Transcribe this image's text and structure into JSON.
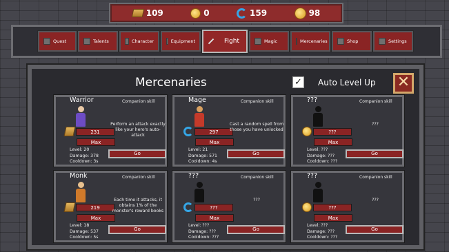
{
  "resources": [
    {
      "icon": "book-icon",
      "value": "109"
    },
    {
      "icon": "coin-icon",
      "value": "0"
    },
    {
      "icon": "mana-swirl-icon",
      "value": "159"
    },
    {
      "icon": "gold-coin-icon",
      "value": "98"
    }
  ],
  "tabs": [
    {
      "label": "Quest",
      "icon": "quest-icon"
    },
    {
      "label": "Talents",
      "icon": "talents-icon"
    },
    {
      "label": "Character",
      "icon": "character-icon"
    },
    {
      "label": "Equipment",
      "icon": "helmet-icon"
    },
    {
      "label": "Fight",
      "icon": "sword-icon",
      "active": true
    },
    {
      "label": "Magic",
      "icon": "wand-icon"
    },
    {
      "label": "Mercenaries",
      "icon": "mercenary-icon"
    },
    {
      "label": "Shop",
      "icon": "coin-icon"
    },
    {
      "label": "Settings",
      "icon": "gear-icon"
    }
  ],
  "panel": {
    "title": "Mercenaries",
    "auto_level_up": {
      "label": "Auto Level Up",
      "checked": true,
      "mark": "✓"
    },
    "close_label": "✕"
  },
  "mercenaries": [
    {
      "name": "Warrior",
      "skill_title": "Companion skill",
      "cost_icon": "book-icon",
      "cost": "231",
      "max": "Max",
      "level": "Level: 20",
      "damage": "Damage: 378",
      "cooldown": "Cooldown: 3s",
      "desc": "Perform an attack exactly like your hero's auto-attack",
      "go": "Go",
      "portrait": {
        "head": "#e9c9a6",
        "body": "#6d4cc4"
      }
    },
    {
      "name": "Mage",
      "skill_title": "Companion skill",
      "cost_icon": "mana-swirl-icon",
      "cost": "297",
      "max": "Max",
      "level": "Level: 21",
      "damage": "Damage: 571",
      "cooldown": "Cooldown: 4s",
      "desc": "Cast a random spell from those you have unlocked",
      "go": "Go",
      "portrait": {
        "head": "#d8a060",
        "body": "#c53a2a"
      }
    },
    {
      "name": "???",
      "skill_title": "Companion skill",
      "cost_icon": "gold-coin-icon",
      "cost": "???",
      "max": "Max",
      "level": "Level: ???",
      "damage": "Damage: ???",
      "cooldown": "Cooldown: ???",
      "desc": "???",
      "go": "Go",
      "portrait": {
        "head": "#111111",
        "body": "#111111"
      }
    },
    {
      "name": "Monk",
      "skill_title": "Companion skill",
      "cost_icon": "book-icon",
      "cost": "219",
      "max": "Max",
      "level": "Level: 18",
      "damage": "Damage: 537",
      "cooldown": "Cooldown: 5s",
      "desc": "Each time it attacks, it obtains 1% of the monster's reward books",
      "go": "Go",
      "portrait": {
        "head": "#e8c18f",
        "body": "#d07a2a"
      }
    },
    {
      "name": "???",
      "skill_title": "Companion skill",
      "cost_icon": "mana-swirl-icon",
      "cost": "???",
      "max": "Max",
      "level": "Level: ???",
      "damage": "Damage: ???",
      "cooldown": "Cooldown: ???",
      "desc": "???",
      "go": "Go",
      "portrait": {
        "head": "#111111",
        "body": "#111111"
      }
    },
    {
      "name": "???",
      "skill_title": "Companion skill",
      "cost_icon": "gold-coin-icon",
      "cost": "???",
      "max": "Max",
      "level": "Level: ???",
      "damage": "Damage: ???",
      "cooldown": "Cooldown: ???",
      "desc": "???",
      "go": "Go",
      "portrait": {
        "head": "#111111",
        "body": "#111111"
      }
    }
  ]
}
